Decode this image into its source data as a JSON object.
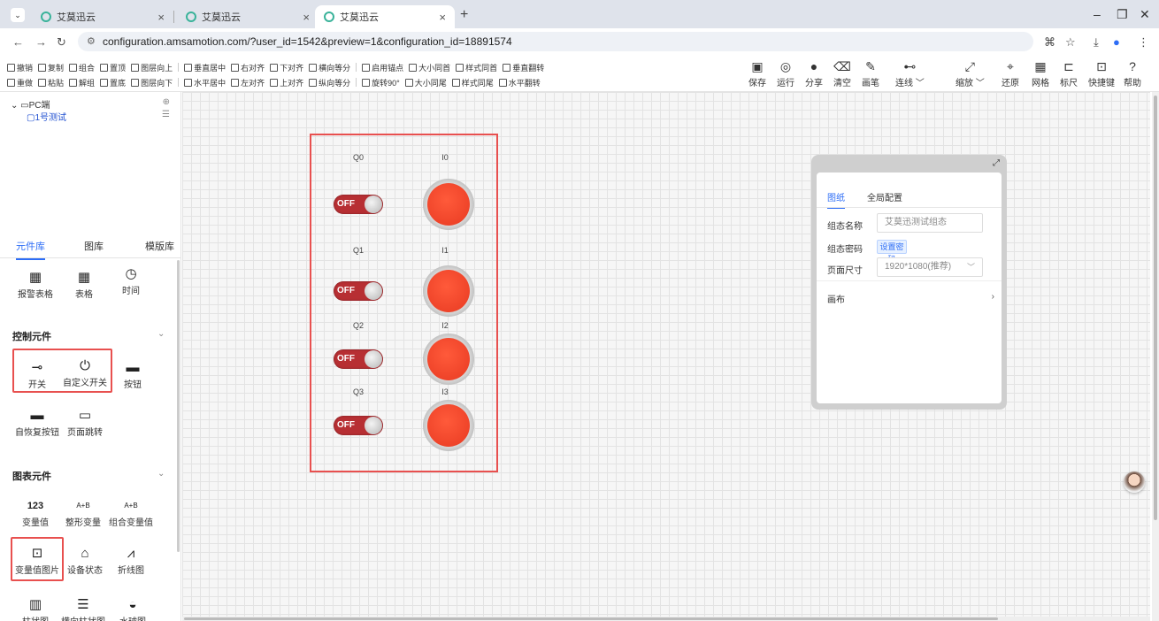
{
  "browser": {
    "tabs": [
      {
        "title": "艾莫迅云"
      },
      {
        "title": "艾莫迅云"
      },
      {
        "title": "艾莫迅云"
      }
    ],
    "url": "configuration.amsamotion.com/?user_id=1542&preview=1&configuration_id=18891574"
  },
  "toolbar": {
    "row1": [
      "撤销",
      "复制",
      "组合",
      "置顶",
      "图层向上",
      "垂直居中",
      "右对齐",
      "下对齐",
      "横向等分",
      "启用锚点",
      "大小同首",
      "样式同首",
      "垂直翻转"
    ],
    "row2": [
      "重做",
      "粘贴",
      "解组",
      "置底",
      "图层向下",
      "水平居中",
      "左对齐",
      "上对齐",
      "纵向等分",
      "旋转90°",
      "大小同尾",
      "样式同尾",
      "水平翻转"
    ],
    "right": [
      {
        "label": "保存",
        "icon": "save-icon"
      },
      {
        "label": "运行",
        "icon": "run-icon"
      },
      {
        "label": "分享",
        "icon": "share-icon"
      },
      {
        "label": "清空",
        "icon": "clear-icon"
      },
      {
        "label": "画笔",
        "icon": "pen-icon"
      },
      {
        "label": "连线 ﹀",
        "icon": "line-icon"
      },
      {
        "label": "缩放 ﹀",
        "icon": "zoom-icon"
      },
      {
        "label": "还原",
        "icon": "restore-icon"
      },
      {
        "label": "网格",
        "icon": "grid-icon"
      },
      {
        "label": "标尺",
        "icon": "ruler-icon"
      },
      {
        "label": "快捷键",
        "icon": "shortcut-icon"
      },
      {
        "label": "帮助",
        "icon": "help-icon"
      }
    ]
  },
  "tree": {
    "root": "PC端",
    "child": "1号测试"
  },
  "library": {
    "tabs": [
      "元件库",
      "图库",
      "模版库"
    ],
    "top_items": [
      "报警表格",
      "表格",
      "时间"
    ],
    "control_section": "控制元件",
    "control_items": [
      "开关",
      "自定义开关",
      "按钮",
      "自恢复按钮",
      "页面跳转"
    ],
    "chart_section": "图表元件",
    "chart_items": [
      "变量值",
      "整形变量",
      "组合变量值",
      "变量值图片",
      "设备状态",
      "折线图",
      "柱状图",
      "横向柱状图",
      "水球图"
    ],
    "chart_glyphs": [
      "123",
      "A+B",
      "A+B"
    ]
  },
  "canvas": {
    "rows": [
      {
        "switch_label": "Q0",
        "lamp_label": "I0",
        "switch_text": "OFF"
      },
      {
        "switch_label": "Q1",
        "lamp_label": "I1",
        "switch_text": "OFF"
      },
      {
        "switch_label": "Q2",
        "lamp_label": "I2",
        "switch_text": "OFF"
      },
      {
        "switch_label": "Q3",
        "lamp_label": "I3",
        "switch_text": "OFF"
      }
    ],
    "colors": {
      "switch": "#b72f33",
      "lamp": "#e83a22",
      "highlight": "#e8504f"
    }
  },
  "props": {
    "tabs": [
      "图纸",
      "全局配置"
    ],
    "name_label": "组态名称",
    "name_value": "艾莫迅测试组态",
    "password_label": "组态密码",
    "password_button": "设置密码",
    "size_label": "页面尺寸",
    "size_value": "1920*1080(推荐)",
    "canvas_label": "画布"
  }
}
